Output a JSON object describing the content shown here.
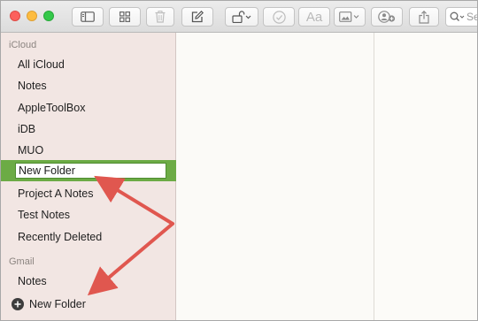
{
  "window": {
    "traffic_lights": [
      "close",
      "minimize",
      "zoom"
    ]
  },
  "toolbar": {
    "buttons": [
      {
        "name": "toggle-sidebar",
        "icon": "sidebar-icon"
      },
      {
        "name": "attachments-browser",
        "icon": "grid-icon"
      },
      {
        "name": "delete",
        "icon": "trash-icon"
      },
      {
        "name": "compose",
        "icon": "compose-icon"
      },
      {
        "name": "lock",
        "icon": "lock-icon"
      },
      {
        "name": "checklist",
        "icon": "checkmark-circle-icon"
      },
      {
        "name": "format",
        "label": "Aa"
      },
      {
        "name": "media",
        "icon": "photo-icon"
      },
      {
        "name": "add-people",
        "icon": "add-person-icon"
      },
      {
        "name": "share",
        "icon": "share-icon"
      }
    ],
    "format_label": "Aa",
    "search_placeholder": "Se"
  },
  "sidebar": {
    "sections": [
      {
        "header": "iCloud",
        "items": [
          {
            "label": "All iCloud"
          },
          {
            "label": "Notes"
          },
          {
            "label": "AppleToolBox"
          },
          {
            "label": "iDB"
          },
          {
            "label": "MUO"
          },
          {
            "label": "New Folder",
            "editing": true
          },
          {
            "label": "Project A Notes"
          },
          {
            "label": "Test Notes"
          },
          {
            "label": "Recently Deleted"
          }
        ]
      },
      {
        "header": "Gmail",
        "items": [
          {
            "label": "Notes"
          }
        ]
      }
    ],
    "new_folder_button": "New Folder",
    "selection_color": "#6cab45"
  },
  "annotation": {
    "arrow_color": "#e0574f"
  }
}
